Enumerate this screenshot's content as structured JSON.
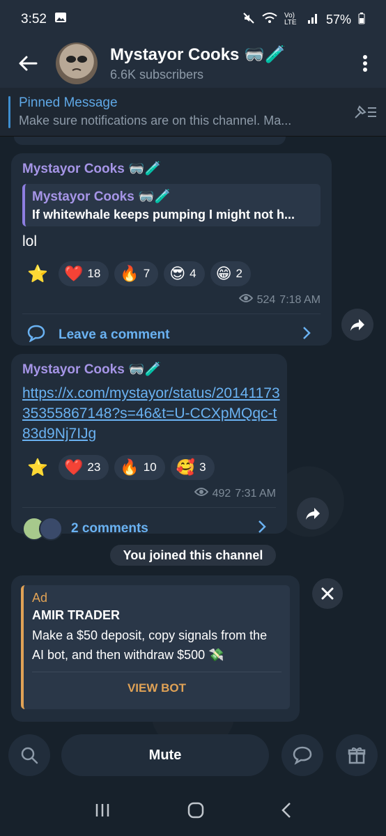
{
  "status": {
    "time": "3:52",
    "battery": "57%",
    "net": "Vo) LTE"
  },
  "header": {
    "channel_name": "Mystayor Cooks 🥽🧪",
    "subscribers": "6.6K subscribers"
  },
  "pinned": {
    "title": "Pinned Message",
    "text": "Make sure notifications are on this channel.   Ma..."
  },
  "post1": {
    "author": "Mystayor Cooks 🥽🧪",
    "reply_author": "Mystayor Cooks 🥽🧪",
    "reply_text": "If whitewhale keeps pumping I might not h...",
    "text": "lol",
    "reactions": [
      {
        "emoji": "❤️",
        "count": "18"
      },
      {
        "emoji": "🔥",
        "count": "7"
      },
      {
        "emoji": "😎",
        "count": "4"
      },
      {
        "emoji": "😁",
        "count": "2"
      }
    ],
    "views": "524",
    "time": "7:18 AM",
    "comment_label": "Leave a comment"
  },
  "post2": {
    "author": "Mystayor Cooks 🥽🧪",
    "link": "https://x.com/mystayor/status/2014117335355867148?s=46&t=U-CCXpMQqc-t83d9Nj7IJg",
    "reactions": [
      {
        "emoji": "❤️",
        "count": "23"
      },
      {
        "emoji": "🔥",
        "count": "10"
      },
      {
        "emoji": "🥰",
        "count": "3"
      }
    ],
    "views": "492",
    "time": "7:31 AM",
    "comment_label": "2 comments"
  },
  "joined": "You joined this channel",
  "ad": {
    "label": "Ad",
    "title": "AMIR TRADER",
    "description": "Make a $50 deposit, copy signals from the AI bot, and then withdraw $500 💸",
    "button": "VIEW BOT"
  },
  "bottom": {
    "mute_label": "Mute"
  }
}
